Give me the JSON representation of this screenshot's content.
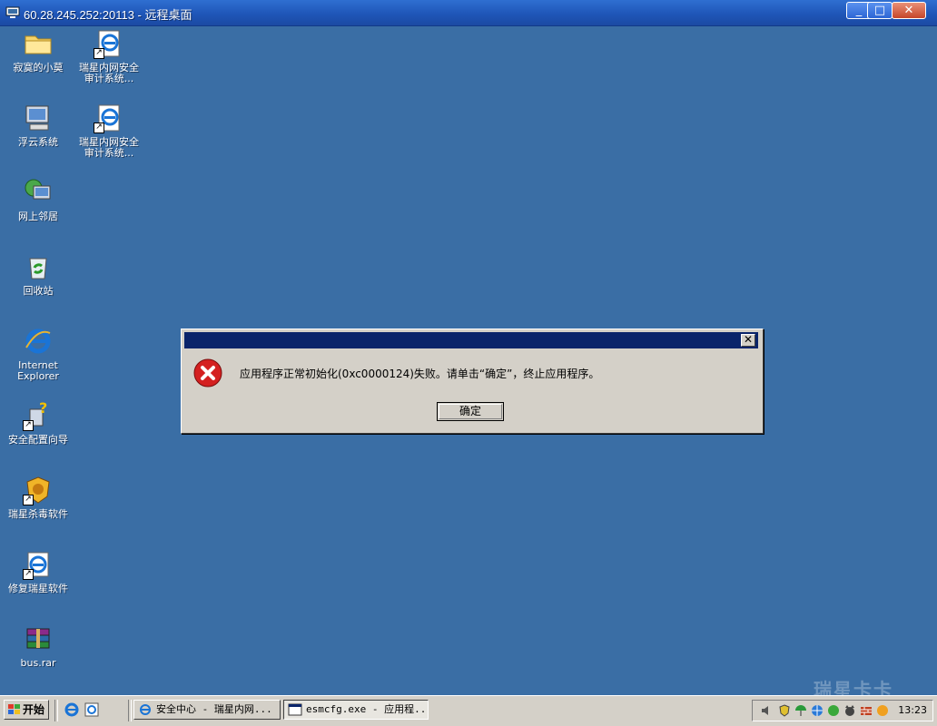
{
  "window": {
    "title": "60.28.245.252:20113 - 远程桌面",
    "buttons": {
      "minimize": "_",
      "maximize": "□",
      "close": "✕"
    }
  },
  "desktop": {
    "icons": [
      {
        "label": "寂寞的小莫",
        "icon": "folder-icon",
        "shortcut": false
      },
      {
        "label": "瑞星内网安全\n审计系统...",
        "icon": "ie-shortcut-icon",
        "shortcut": true
      },
      {
        "label": "浮云系统",
        "icon": "my-computer-icon",
        "shortcut": false
      },
      {
        "label": "瑞星内网安全\n审计系统...",
        "icon": "ie-shortcut-icon",
        "shortcut": true
      },
      {
        "label": "网上邻居",
        "icon": "network-places-icon",
        "shortcut": false
      },
      {
        "label": "回收站",
        "icon": "recycle-bin-icon",
        "shortcut": false
      },
      {
        "label": "Internet\nExplorer",
        "icon": "internet-explorer-icon",
        "shortcut": false
      },
      {
        "label": "安全配置向导",
        "icon": "security-wizard-icon",
        "shortcut": true
      },
      {
        "label": "瑞星杀毒软件",
        "icon": "rising-antivirus-icon",
        "shortcut": true
      },
      {
        "label": "修复瑞星软件",
        "icon": "repair-rising-icon",
        "shortcut": true
      },
      {
        "label": "bus.rar",
        "icon": "winrar-archive-icon",
        "shortcut": false
      }
    ]
  },
  "dialog": {
    "title": "",
    "message": "应用程序正常初始化(0xc0000124)失败。请单击“确定”，终止应用程序。",
    "ok_label": "确定",
    "close_glyph": "✕"
  },
  "taskbar": {
    "start_label": "开始",
    "tasks": [
      {
        "label": "安全中心 - 瑞星内网...",
        "active": false
      },
      {
        "label": "esmcfg.exe - 应用程...",
        "active": true
      }
    ],
    "clock": "13:23"
  },
  "watermark": "瑞星卡卡",
  "colors": {
    "desktop": "#3a6ea5",
    "dialog_title": "#0a246a",
    "taskbar": "#d4d0c8",
    "error_red": "#d42020"
  }
}
